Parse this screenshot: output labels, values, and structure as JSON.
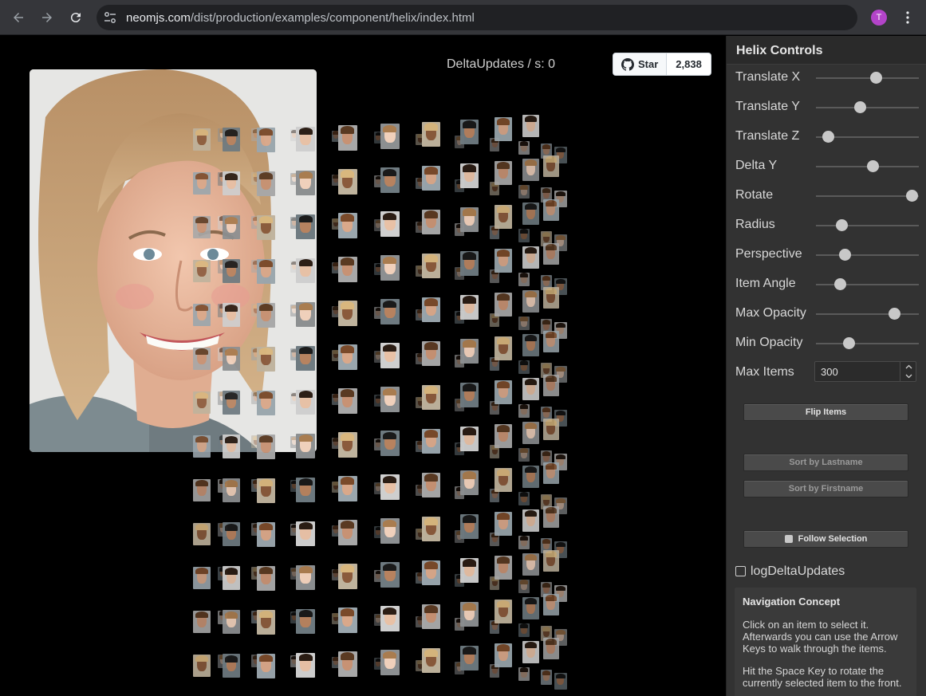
{
  "browser": {
    "url_host": "neomjs.com",
    "url_path": "/dist/production/examples/component/helix/index.html",
    "profile_initial": "T"
  },
  "stage": {
    "delta_label": "DeltaUpdates / s: 0",
    "github": {
      "star_label": "Star",
      "star_count": "2,838"
    }
  },
  "panel": {
    "title": "Helix Controls",
    "sliders": [
      {
        "label": "Translate X",
        "level": 0.58
      },
      {
        "label": "Translate Y",
        "level": 0.43
      },
      {
        "label": "Translate Z",
        "level": 0.12
      },
      {
        "label": "Delta Y",
        "level": 0.55
      },
      {
        "label": "Rotate",
        "level": 0.93
      },
      {
        "label": "Radius",
        "level": 0.25
      },
      {
        "label": "Perspective",
        "level": 0.28
      },
      {
        "label": "Item Angle",
        "level": 0.23
      },
      {
        "label": "Max Opacity",
        "level": 0.76
      },
      {
        "label": "Min Opacity",
        "level": 0.32
      }
    ],
    "max_items": {
      "label": "Max Items",
      "value": "300"
    },
    "buttons": {
      "flip": "Flip Items",
      "sort_lastname": "Sort by Lastname",
      "sort_firstname": "Sort by Firstname",
      "follow": "Follow Selection"
    },
    "log_checkbox": "logDeltaUpdates",
    "nav_concept": {
      "title": "Navigation Concept",
      "p1": "Click on an item to select it. Afterwards you can use the Arrow Keys to walk through the items.",
      "p2": "Hit the Space Key to rotate the currently selected item to the front."
    }
  },
  "colors": {
    "panel_bg": "#323232",
    "stage_bg": "#000000",
    "profile": "#b344c9"
  }
}
